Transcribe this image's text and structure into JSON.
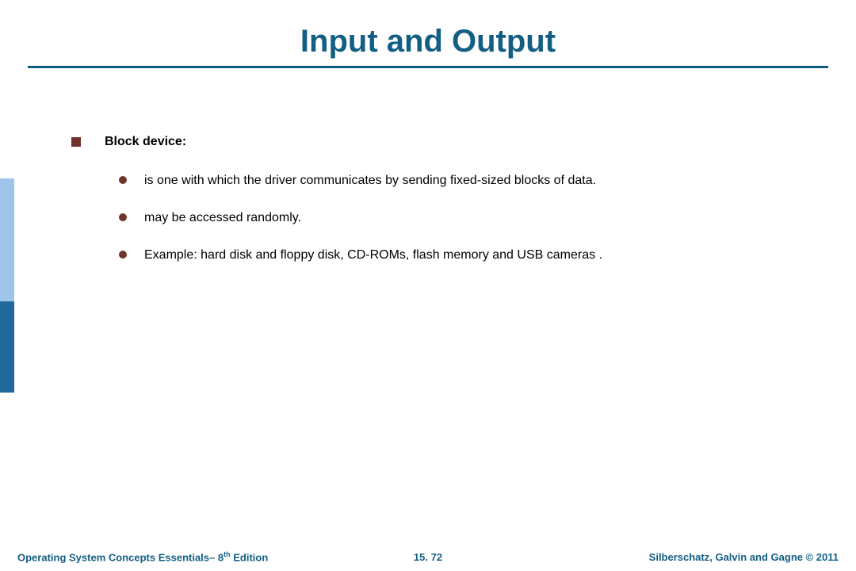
{
  "title": "Input and Output",
  "heading": "Block device:",
  "bullets": [
    " is one with which the driver communicates by sending fixed-sized blocks of data.",
    "may be accessed randomly.",
    "Example: hard disk and floppy disk, CD-ROMs, flash memory and USB cameras ."
  ],
  "footer": {
    "left_pre": "Operating System Concepts Essentials– 8",
    "left_sup": "th",
    "left_post": " Edition",
    "center": "15. 72",
    "right": "Silberschatz, Galvin and Gagne © 2011"
  }
}
